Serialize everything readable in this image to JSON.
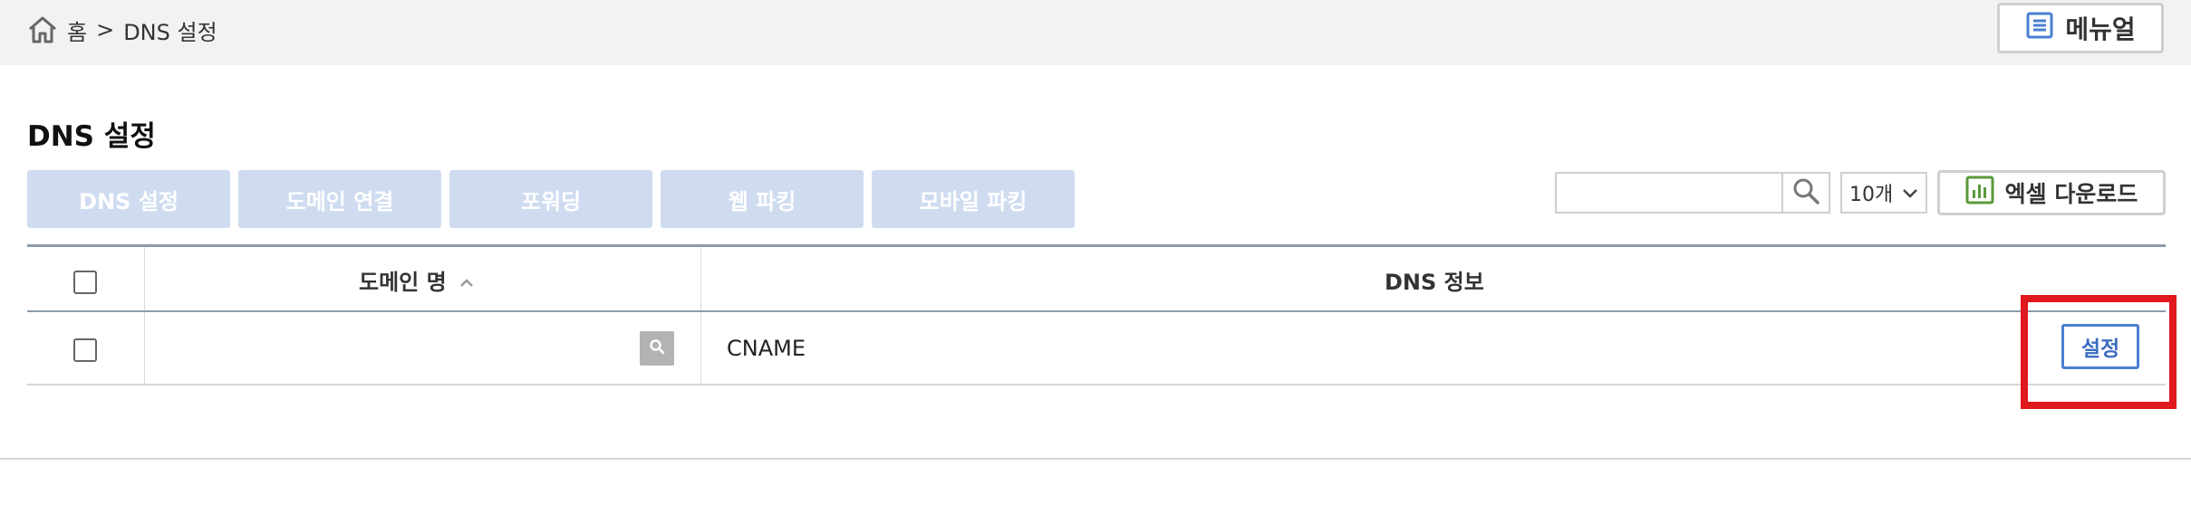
{
  "breadcrumb": {
    "home": "홈",
    "separator": ">",
    "current": "DNS 설정"
  },
  "header": {
    "manual_label": "메뉴얼"
  },
  "page": {
    "title": "DNS 설정"
  },
  "tabs": [
    {
      "label": "DNS 설정"
    },
    {
      "label": "도메인 연결"
    },
    {
      "label": "포워딩"
    },
    {
      "label": "웹 파킹"
    },
    {
      "label": "모바일 파킹"
    }
  ],
  "toolbar": {
    "search_value": "",
    "page_size": "10개",
    "excel_label": "엑셀 다운로드"
  },
  "table": {
    "columns": [
      {
        "label": "도메인 명",
        "sort": "ascending"
      },
      {
        "label": "DNS 정보"
      }
    ],
    "rows": [
      {
        "domain": "",
        "dns_type": "CNAME",
        "action_label": "설정"
      }
    ]
  },
  "colors": {
    "tab_bg": "#cfdcf0",
    "accent": "#4a7fd1",
    "highlight": "#e0191f",
    "topbar": "#f2f2f2"
  },
  "icons": {
    "home": "home-icon",
    "manual": "document-icon",
    "search": "search-icon",
    "dropdown": "chevron-down-icon",
    "excel": "chart-icon",
    "sort": "chevron-up-icon"
  }
}
